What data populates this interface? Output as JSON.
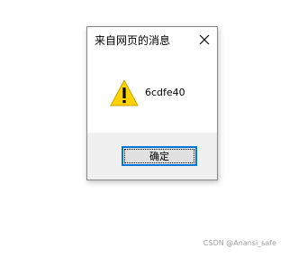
{
  "dialog": {
    "title": "来自网页的消息",
    "message": "6cdfe40",
    "ok_label": "确定",
    "icon": "warning-icon",
    "close_icon": "close-icon"
  },
  "watermark": "CSDN @Anansi_safe",
  "colors": {
    "accent": "#0078d7",
    "footer_bg": "#f0f0f0",
    "warning_fill": "#ffd200"
  }
}
